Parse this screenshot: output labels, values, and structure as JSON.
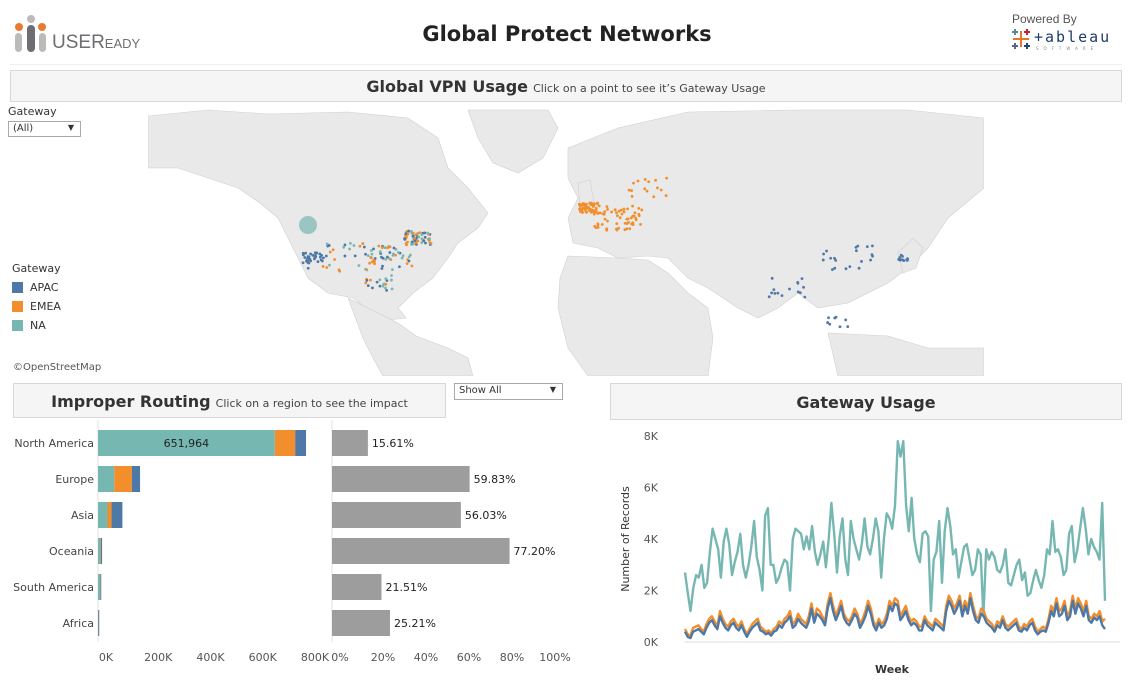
{
  "header": {
    "logo_text_main": "USER",
    "logo_text_small": "EADY",
    "title": "Global Protect Networks",
    "powered_by": "Powered By",
    "tableau_word": "+ableau",
    "tableau_sub": "SOFTWARE"
  },
  "vpn_section": {
    "title": "Global VPN Usage",
    "subtitle": "Click on a point to see it’s  Gateway Usage",
    "filter_label": "Gateway",
    "filter_value": "(All)",
    "legend_title": "Gateway",
    "legend": [
      {
        "label": "APAC",
        "color": "#4e79a7"
      },
      {
        "label": "EMEA",
        "color": "#f28e2b"
      },
      {
        "label": "NA",
        "color": "#76b7b2"
      }
    ],
    "attribution": "©OpenStreetMap"
  },
  "routing_section": {
    "title": "Improper Routing",
    "subtitle": "Click on a region to see the impact",
    "filter_value": "Show All"
  },
  "gateway_section": {
    "title": "Gateway Usage"
  },
  "chart_data": [
    {
      "type": "bar",
      "name": "improper-routing-count",
      "orientation": "horizontal",
      "stacked": true,
      "categories": [
        "North America",
        "Europe",
        "Asia",
        "Oceania",
        "South America",
        "Africa"
      ],
      "series": [
        {
          "name": "NA",
          "color": "#76b7b2",
          "values": [
            651964,
            60000,
            35000,
            9000,
            8000,
            1000
          ]
        },
        {
          "name": "EMEA",
          "color": "#f28e2b",
          "values": [
            75000,
            65000,
            15000,
            2000,
            1000,
            500
          ]
        },
        {
          "name": "APAC",
          "color": "#4e79a7",
          "values": [
            40000,
            30000,
            40000,
            4000,
            1000,
            1500
          ]
        }
      ],
      "data_labels": [
        {
          "category": "North America",
          "text": "651,964"
        }
      ],
      "xticks": [
        "0K",
        "200K",
        "400K",
        "600K",
        "800K"
      ],
      "xlim": [
        0,
        800000
      ]
    },
    {
      "type": "bar",
      "name": "improper-routing-percent",
      "orientation": "horizontal",
      "categories": [
        "North America",
        "Europe",
        "Asia",
        "Oceania",
        "South America",
        "Africa"
      ],
      "values": [
        15.61,
        59.83,
        56.03,
        77.2,
        21.51,
        25.21
      ],
      "labels": [
        "15.61%",
        "59.83%",
        "56.03%",
        "77.20%",
        "21.51%",
        "25.21%"
      ],
      "color": "#9d9d9d",
      "xticks": [
        "0%",
        "20%",
        "40%",
        "60%",
        "80%",
        "100%"
      ],
      "xlim": [
        0,
        100
      ]
    },
    {
      "type": "line",
      "name": "gateway-usage",
      "title": "Gateway Usage",
      "xlabel": "Week",
      "ylabel": "Number of Records",
      "yticks": [
        "0K",
        "2K",
        "4K",
        "6K",
        "8K"
      ],
      "ylim": [
        0,
        8000
      ],
      "series": [
        {
          "name": "NA",
          "color": "#76b7b2",
          "values": [
            2700,
            1900,
            1200,
            2100,
            2600,
            2500,
            3000,
            2100,
            2300,
            3500,
            4400,
            4000,
            3600,
            2500,
            3900,
            4400,
            3800,
            2600,
            3100,
            3500,
            4200,
            3000,
            2500,
            3000,
            3700,
            4700,
            3300,
            2800,
            2000,
            4900,
            5200,
            3000,
            3000,
            2300,
            2500,
            2900,
            3200,
            3100,
            2000,
            4000,
            4400,
            4300,
            4200,
            3600,
            4100,
            3600,
            4500,
            3500,
            3000,
            3400,
            3900,
            2900,
            4000,
            5400,
            4200,
            2700,
            4100,
            4800,
            3200,
            2600,
            4700,
            4000,
            3600,
            3200,
            3800,
            4800,
            3700,
            3400,
            4000,
            4800,
            4300,
            2500,
            4000,
            5000,
            4800,
            4400,
            5300,
            7800,
            7200,
            7800,
            5300,
            4300,
            5600,
            4000,
            3400,
            3100,
            4200,
            4300,
            4100,
            1200,
            3200,
            3500,
            4700,
            2300,
            4300,
            5200,
            4500,
            3400,
            3600,
            2500,
            3100,
            3700,
            3800,
            3200,
            2600,
            2800,
            3600,
            3400,
            1000,
            3600,
            3200,
            3500,
            3300,
            2800,
            2700,
            3000,
            3600,
            2300,
            2200,
            2600,
            3000,
            3200,
            2400,
            2700,
            1800,
            1900,
            2400,
            2800,
            2400,
            2100,
            2600,
            3600,
            3400,
            4700,
            3500,
            3600,
            3300,
            2600,
            2800,
            4200,
            4500,
            3100,
            3600,
            4400,
            5200,
            4400,
            3400,
            4000,
            3700,
            3500,
            3200,
            5400,
            1600
          ]
        },
        {
          "name": "EMEA",
          "color": "#f28e2b",
          "values": [
            500,
            300,
            250,
            550,
            600,
            650,
            500,
            400,
            700,
            900,
            1000,
            800,
            600,
            1200,
            900,
            700,
            600,
            800,
            900,
            700,
            600,
            800,
            500,
            300,
            500,
            700,
            800,
            900,
            600,
            500,
            400,
            450,
            350,
            500,
            600,
            800,
            700,
            900,
            1000,
            1200,
            700,
            800,
            1100,
            900,
            800,
            700,
            1000,
            1500,
            900,
            1300,
            1200,
            1000,
            800,
            1500,
            1900,
            1400,
            1000,
            1300,
            1600,
            1100,
            900,
            800,
            1000,
            1300,
            1100,
            700,
            900,
            1200,
            1600,
            1300,
            800,
            600,
            900,
            700,
            800,
            1100,
            1600,
            1400,
            1700,
            1600,
            1000,
            1200,
            1400,
            1000,
            800,
            900,
            800,
            600,
            600,
            1000,
            800,
            700,
            600,
            900,
            800,
            700,
            600,
            1400,
            1800,
            1600,
            1300,
            1500,
            1800,
            1200,
            1600,
            1300,
            1900,
            1400,
            1000,
            900,
            1300,
            1200,
            900,
            800,
            700,
            500,
            800,
            700,
            1000,
            700,
            600,
            700,
            800,
            900,
            600,
            500,
            700,
            600,
            800,
            900,
            600,
            400,
            500,
            600,
            500,
            900,
            1400,
            1200,
            1700,
            1200,
            1300,
            1600,
            1000,
            1200,
            1800,
            1300,
            1700,
            1500,
            1200,
            1600,
            1000,
            900,
            1100,
            1000,
            1200,
            800,
            900
          ]
        },
        {
          "name": "APAC",
          "color": "#4e79a7",
          "values": [
            400,
            200,
            150,
            400,
            450,
            500,
            400,
            300,
            550,
            750,
            850,
            650,
            500,
            1000,
            750,
            550,
            450,
            650,
            750,
            550,
            450,
            650,
            400,
            200,
            400,
            550,
            650,
            750,
            450,
            400,
            300,
            350,
            250,
            400,
            450,
            650,
            550,
            750,
            850,
            1000,
            550,
            650,
            900,
            750,
            650,
            550,
            800,
            1300,
            750,
            1100,
            1000,
            850,
            650,
            1300,
            1700,
            1200,
            850,
            1100,
            1400,
            950,
            750,
            650,
            850,
            1100,
            950,
            550,
            750,
            1000,
            1400,
            1100,
            650,
            450,
            750,
            550,
            650,
            900,
            1400,
            1200,
            1500,
            1400,
            850,
            1000,
            1200,
            850,
            650,
            750,
            650,
            450,
            450,
            850,
            650,
            550,
            450,
            750,
            650,
            550,
            450,
            1200,
            1600,
            1400,
            1100,
            1300,
            1600,
            1000,
            1400,
            1100,
            1700,
            1200,
            850,
            750,
            1100,
            1000,
            750,
            650,
            550,
            400,
            650,
            550,
            850,
            550,
            450,
            550,
            650,
            750,
            450,
            400,
            550,
            450,
            650,
            750,
            450,
            300,
            400,
            450,
            400,
            750,
            1200,
            1000,
            1500,
            1000,
            1100,
            1400,
            850,
            1000,
            1600,
            1100,
            1500,
            1300,
            1000,
            1400,
            850,
            750,
            950,
            850,
            1000,
            650,
            500
          ]
        }
      ]
    }
  ]
}
